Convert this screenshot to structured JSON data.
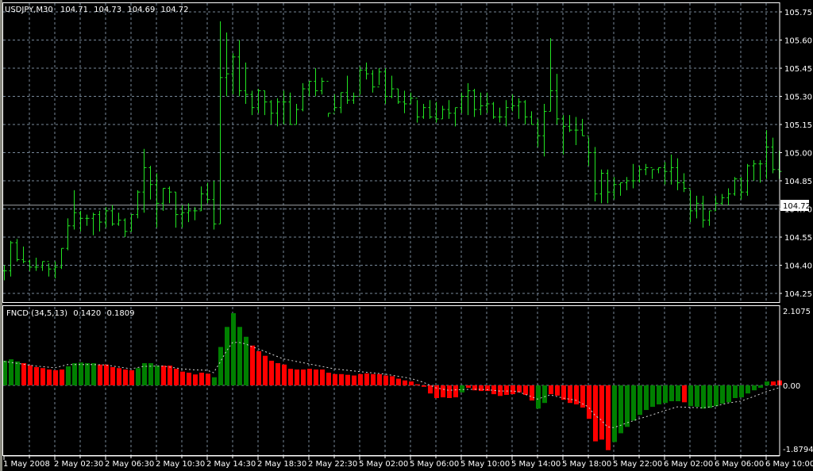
{
  "header": {
    "symbol": "USDJPY,M30",
    "open": "104.71",
    "high": "104.73",
    "low": "104.69",
    "close": "104.72"
  },
  "indicator_header": {
    "name": "FNCD (34,5,13)",
    "value1": "0.1420",
    "value2": "0.1809"
  },
  "current_price_label": "104.72",
  "colors": {
    "background": "#000000",
    "bars": "#22e422",
    "grid": "#778899",
    "hist_up": "#008000",
    "hist_down": "#ff0000",
    "signal": "#d0d0d0",
    "price_line": "#a0a4a8",
    "axis": "#ffffff"
  },
  "chart_data": [
    {
      "type": "ohlc-bar",
      "title": "USDJPY,M30",
      "ylim": [
        104.25,
        105.75
      ],
      "y_ticks": [
        "105.75",
        "105.60",
        "105.45",
        "105.30",
        "105.15",
        "105.00",
        "104.85",
        "104.70",
        "104.55",
        "104.40",
        "104.25"
      ],
      "x_ticks": [
        "1 May 2008",
        "2 May 02:30",
        "2 May 06:30",
        "2 May 10:30",
        "2 May 14:30",
        "2 May 18:30",
        "2 May 22:30",
        "5 May 02:00",
        "5 May 06:00",
        "5 May 10:00",
        "5 May 14:00",
        "5 May 18:00",
        "5 May 22:00",
        "6 May 02:00",
        "6 May 06:00",
        "6 May 10:00"
      ],
      "grid": true,
      "bars_hlc": [
        [
          104.4,
          104.32,
          104.37
        ],
        [
          104.53,
          104.34,
          104.52
        ],
        [
          104.54,
          104.42,
          104.43
        ],
        [
          104.5,
          104.41,
          104.42
        ],
        [
          104.43,
          104.37,
          104.39
        ],
        [
          104.44,
          104.37,
          104.39
        ],
        [
          104.42,
          104.37,
          104.42
        ],
        [
          104.41,
          104.34,
          104.38
        ],
        [
          104.42,
          104.33,
          104.39
        ],
        [
          104.49,
          104.38,
          104.49
        ],
        [
          104.65,
          104.48,
          104.61
        ],
        [
          104.8,
          104.59,
          104.68
        ],
        [
          104.69,
          104.58,
          104.65
        ],
        [
          104.67,
          104.61,
          104.65
        ],
        [
          104.68,
          104.56,
          104.67
        ],
        [
          104.69,
          104.58,
          104.63
        ],
        [
          104.71,
          104.6,
          104.69
        ],
        [
          104.72,
          104.61,
          104.62
        ],
        [
          104.68,
          104.61,
          104.64
        ],
        [
          104.65,
          104.55,
          104.58
        ],
        [
          104.67,
          104.58,
          104.67
        ],
        [
          104.8,
          104.65,
          104.79
        ],
        [
          105.02,
          104.68,
          104.92
        ],
        [
          104.93,
          104.75,
          104.83
        ],
        [
          104.89,
          104.6,
          104.73
        ],
        [
          104.81,
          104.69,
          104.81
        ],
        [
          104.82,
          104.73,
          104.79
        ],
        [
          104.79,
          104.6,
          104.67
        ],
        [
          104.72,
          104.6,
          104.68
        ],
        [
          104.73,
          104.63,
          104.69
        ],
        [
          104.71,
          104.64,
          104.69
        ],
        [
          104.82,
          104.69,
          104.78
        ],
        [
          104.84,
          104.73,
          104.75
        ],
        [
          104.85,
          104.59,
          104.62
        ],
        [
          105.7,
          104.62,
          105.4
        ],
        [
          105.64,
          105.3,
          105.42
        ],
        [
          105.53,
          105.31,
          105.51
        ],
        [
          105.6,
          105.3,
          105.33
        ],
        [
          105.48,
          105.26,
          105.31
        ],
        [
          105.33,
          105.2,
          105.24
        ],
        [
          105.34,
          105.21,
          105.33
        ],
        [
          105.33,
          105.2,
          105.27
        ],
        [
          105.28,
          105.15,
          105.21
        ],
        [
          105.29,
          105.14,
          105.27
        ],
        [
          105.33,
          105.15,
          105.27
        ],
        [
          105.32,
          105.15,
          105.15
        ],
        [
          105.26,
          105.15,
          105.23
        ],
        [
          105.37,
          105.22,
          105.34
        ],
        [
          105.38,
          105.3,
          105.38
        ],
        [
          105.45,
          105.3,
          105.33
        ],
        [
          105.4,
          105.31,
          105.38
        ],
        [
          105.21,
          105.19,
          105.21
        ],
        [
          105.31,
          105.22,
          105.24
        ],
        [
          105.32,
          105.21,
          105.32
        ],
        [
          105.41,
          105.26,
          105.28
        ],
        [
          105.32,
          105.26,
          105.3
        ],
        [
          105.46,
          105.31,
          105.44
        ],
        [
          105.48,
          105.39,
          105.42
        ],
        [
          105.44,
          105.32,
          105.35
        ],
        [
          105.45,
          105.36,
          105.43
        ],
        [
          105.45,
          105.26,
          105.3
        ],
        [
          105.41,
          105.29,
          105.34
        ],
        [
          105.34,
          105.26,
          105.27
        ],
        [
          105.33,
          105.21,
          105.26
        ],
        [
          105.32,
          105.26,
          105.29
        ],
        [
          105.28,
          105.16,
          105.19
        ],
        [
          105.26,
          105.18,
          105.24
        ],
        [
          105.28,
          105.18,
          105.19
        ],
        [
          105.27,
          105.16,
          105.18
        ],
        [
          105.25,
          105.18,
          105.23
        ],
        [
          105.28,
          105.18,
          105.21
        ],
        [
          105.24,
          105.14,
          105.24
        ],
        [
          105.32,
          105.21,
          105.3
        ],
        [
          105.37,
          105.2,
          105.33
        ],
        [
          105.34,
          105.19,
          105.23
        ],
        [
          105.32,
          105.2,
          105.25
        ],
        [
          105.32,
          105.21,
          105.26
        ],
        [
          105.27,
          105.18,
          105.19
        ],
        [
          105.24,
          105.16,
          105.19
        ],
        [
          105.28,
          105.14,
          105.24
        ],
        [
          105.31,
          105.22,
          105.25
        ],
        [
          105.29,
          105.18,
          105.27
        ],
        [
          105.28,
          105.15,
          105.19
        ],
        [
          105.22,
          105.15,
          105.15
        ],
        [
          105.18,
          105.03,
          105.09
        ],
        [
          105.26,
          104.98,
          105.22
        ],
        [
          105.61,
          105.22,
          105.33
        ],
        [
          105.42,
          105.15,
          105.18
        ],
        [
          105.2,
          104.99,
          105.14
        ],
        [
          105.2,
          105.11,
          105.12
        ],
        [
          105.19,
          105.04,
          105.12
        ],
        [
          105.18,
          105.09,
          105.09
        ],
        [
          105.08,
          104.93,
          105.0
        ],
        [
          105.03,
          104.74,
          104.78
        ],
        [
          104.91,
          104.73,
          104.89
        ],
        [
          104.91,
          104.73,
          104.79
        ],
        [
          104.87,
          104.75,
          104.83
        ],
        [
          104.84,
          104.77,
          104.84
        ],
        [
          104.87,
          104.8,
          104.85
        ],
        [
          104.94,
          104.81,
          104.85
        ],
        [
          104.93,
          104.84,
          104.91
        ],
        [
          104.94,
          104.88,
          104.92
        ],
        [
          104.91,
          104.86,
          104.91
        ],
        [
          104.92,
          104.89,
          104.92
        ],
        [
          104.95,
          104.83,
          104.9
        ],
        [
          104.99,
          104.83,
          104.92
        ],
        [
          104.97,
          104.8,
          104.84
        ],
        [
          104.89,
          104.79,
          104.81
        ],
        [
          104.8,
          104.63,
          104.69
        ],
        [
          104.77,
          104.65,
          104.73
        ],
        [
          104.77,
          104.6,
          104.64
        ],
        [
          104.69,
          104.61,
          104.69
        ],
        [
          104.77,
          104.69,
          104.73
        ],
        [
          104.78,
          104.72,
          104.76
        ],
        [
          104.81,
          104.72,
          104.78
        ],
        [
          104.87,
          104.77,
          104.86
        ],
        [
          104.87,
          104.75,
          104.79
        ],
        [
          104.94,
          104.77,
          104.93
        ],
        [
          104.96,
          104.85,
          104.94
        ],
        [
          104.96,
          104.84,
          104.94
        ],
        [
          105.12,
          104.86,
          105.03
        ],
        [
          105.08,
          104.89,
          104.91
        ],
        [
          105.01,
          104.86,
          104.9
        ]
      ],
      "current_price": 104.72
    },
    {
      "type": "bar",
      "title": "FNCD (34,5,13)",
      "ylim": [
        -1.8794,
        2.1075
      ],
      "y_ticks": [
        "2.1075",
        "0.00",
        "-1.8794"
      ],
      "histogram": [
        0.7,
        0.74,
        0.68,
        0.63,
        0.57,
        0.52,
        0.49,
        0.45,
        0.43,
        0.45,
        0.54,
        0.63,
        0.65,
        0.63,
        0.63,
        0.59,
        0.59,
        0.52,
        0.49,
        0.45,
        0.43,
        0.49,
        0.63,
        0.63,
        0.56,
        0.56,
        0.56,
        0.47,
        0.39,
        0.36,
        0.31,
        0.36,
        0.33,
        0.23,
        1.09,
        1.66,
        2.05,
        1.66,
        1.38,
        1.13,
        0.97,
        0.84,
        0.7,
        0.63,
        0.59,
        0.47,
        0.45,
        0.45,
        0.47,
        0.45,
        0.45,
        0.36,
        0.32,
        0.32,
        0.3,
        0.28,
        0.32,
        0.34,
        0.32,
        0.32,
        0.28,
        0.26,
        0.19,
        0.14,
        0.11,
        0.03,
        -0.04,
        -0.23,
        -0.36,
        -0.34,
        -0.36,
        -0.34,
        -0.2,
        -0.07,
        -0.14,
        -0.16,
        -0.16,
        -0.25,
        -0.3,
        -0.27,
        -0.25,
        -0.2,
        -0.27,
        -0.43,
        -0.66,
        -0.5,
        -0.25,
        -0.29,
        -0.41,
        -0.5,
        -0.54,
        -0.63,
        -0.95,
        -1.59,
        -1.54,
        -1.84,
        -1.61,
        -1.36,
        -1.18,
        -1.0,
        -0.84,
        -0.7,
        -0.61,
        -0.54,
        -0.5,
        -0.45,
        -0.45,
        -0.48,
        -0.59,
        -0.61,
        -0.66,
        -0.64,
        -0.59,
        -0.52,
        -0.48,
        -0.36,
        -0.34,
        -0.23,
        -0.14,
        -0.07,
        0.11,
        0.11,
        0.14
      ],
      "histogram_colors": "gggrrrrrrrgggggrrrrrrggggrrrrrrrrggggggrrrrrrrrrrrrrrrrrrrrrrrrrrrrrrrrrgrrrrrrrrrrrggrrrrrrrrrrgggggggggggrggggggggggggg",
      "signal_points": [
        [
          0,
          0.68
        ],
        [
          5,
          0.55
        ],
        [
          8,
          0.5
        ],
        [
          10,
          0.59
        ],
        [
          14,
          0.59
        ],
        [
          16,
          0.58
        ],
        [
          20,
          0.47
        ],
        [
          22,
          0.54
        ],
        [
          25,
          0.55
        ],
        [
          28,
          0.47
        ],
        [
          30,
          0.44
        ],
        [
          32,
          0.43
        ],
        [
          33,
          0.36
        ],
        [
          34,
          0.65
        ],
        [
          35,
          0.97
        ],
        [
          36,
          1.22
        ],
        [
          37,
          1.22
        ],
        [
          38,
          1.18
        ],
        [
          39,
          1.1
        ],
        [
          40,
          1.04
        ],
        [
          44,
          0.75
        ],
        [
          48,
          0.61
        ],
        [
          52,
          0.47
        ],
        [
          56,
          0.39
        ],
        [
          60,
          0.32
        ],
        [
          64,
          0.2
        ],
        [
          66,
          0.09
        ],
        [
          68,
          -0.07
        ],
        [
          70,
          -0.14
        ],
        [
          72,
          -0.12
        ],
        [
          74,
          -0.11
        ],
        [
          76,
          -0.12
        ],
        [
          78,
          -0.16
        ],
        [
          80,
          -0.16
        ],
        [
          81,
          -0.18
        ],
        [
          84,
          -0.39
        ],
        [
          86,
          -0.27
        ],
        [
          88,
          -0.36
        ],
        [
          90,
          -0.42
        ],
        [
          92,
          -0.61
        ],
        [
          93,
          -0.84
        ],
        [
          94,
          -0.98
        ],
        [
          95,
          -1.18
        ],
        [
          96,
          -1.2
        ],
        [
          97,
          -1.14
        ],
        [
          98,
          -1.07
        ],
        [
          100,
          -0.95
        ],
        [
          102,
          -0.84
        ],
        [
          104,
          -0.72
        ],
        [
          106,
          -0.61
        ],
        [
          110,
          -0.64
        ],
        [
          112,
          -0.59
        ],
        [
          114,
          -0.5
        ],
        [
          116,
          -0.45
        ],
        [
          118,
          -0.32
        ],
        [
          120,
          -0.18
        ],
        [
          122,
          -0.07
        ]
      ]
    }
  ]
}
